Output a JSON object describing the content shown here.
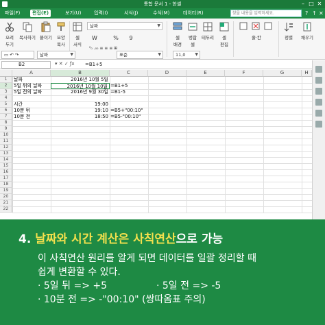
{
  "window": {
    "title": "통합 문서 1 - 한셀",
    "minimize": "–",
    "maximize": "□",
    "close": "✕"
  },
  "menu": {
    "items": [
      "파일(F)",
      "편집(E)",
      "보기(U)",
      "입력(I)",
      "서식(J)",
      "수식(M)",
      "데이터(R)"
    ],
    "active_index": 1,
    "search_placeholder": "찾을 내용을 입력하세요.",
    "right_icons": [
      "?",
      "↑",
      "✕"
    ]
  },
  "ribbon": {
    "cut": "오려\n두기",
    "copy": "복사하기",
    "paste": "붙이기",
    "format_copy": "모양\n복사",
    "cell_style": "셀\n서식",
    "font_name": "날짜",
    "font_size": "11,0",
    "bold": "W",
    "percent": "%",
    "comma": "9",
    "insert": "셀\n배경",
    "merge": "병합\n셀",
    "border": "테두리",
    "cell_edit": "셀\n편집",
    "rows": "줄·칸",
    "sort": "정렬",
    "fill": "채우기",
    "number_format": "날짜",
    "chart_label": "표준"
  },
  "formula_bar": {
    "cell_ref": "B2",
    "formula": "=B1+5"
  },
  "sheet": {
    "columns": [
      "A",
      "B",
      "C",
      "D",
      "E",
      "F",
      "G",
      "H"
    ],
    "selected_column": "B",
    "selected_row": 2,
    "rows": [
      {
        "n": "1",
        "a": "날짜",
        "b": "2016년 10월 5일",
        "c": ""
      },
      {
        "n": "2",
        "a": "5일 뒤의 날짜",
        "b": "2016년 10월 10일",
        "c": "=B1+5"
      },
      {
        "n": "3",
        "a": "5일 전의 날짜",
        "b": "2016년 9월 30일",
        "c": "=B1-5"
      },
      {
        "n": "4",
        "a": "",
        "b": "",
        "c": ""
      },
      {
        "n": "5",
        "a": "시간",
        "b": "19:00",
        "c": ""
      },
      {
        "n": "6",
        "a": "10분 뒤",
        "b": "19:10",
        "c": "=B5+\"00:10\""
      },
      {
        "n": "7",
        "a": "10분 전",
        "b": "18:50",
        "c": "=B5-\"00:10\""
      },
      {
        "n": "8",
        "a": "",
        "b": "",
        "c": ""
      },
      {
        "n": "9",
        "a": "",
        "b": "",
        "c": ""
      },
      {
        "n": "10",
        "a": "",
        "b": "",
        "c": ""
      },
      {
        "n": "11",
        "a": "",
        "b": "",
        "c": ""
      },
      {
        "n": "12",
        "a": "",
        "b": "",
        "c": ""
      },
      {
        "n": "13",
        "a": "",
        "b": "",
        "c": ""
      },
      {
        "n": "14",
        "a": "",
        "b": "",
        "c": ""
      },
      {
        "n": "15",
        "a": "",
        "b": "",
        "c": ""
      },
      {
        "n": "16",
        "a": "",
        "b": "",
        "c": ""
      },
      {
        "n": "17",
        "a": "",
        "b": "",
        "c": ""
      },
      {
        "n": "18",
        "a": "",
        "b": "",
        "c": ""
      },
      {
        "n": "19",
        "a": "",
        "b": "",
        "c": ""
      },
      {
        "n": "20",
        "a": "",
        "b": "",
        "c": ""
      },
      {
        "n": "21",
        "a": "",
        "b": "",
        "c": ""
      },
      {
        "n": "22",
        "a": "",
        "b": "",
        "c": ""
      }
    ]
  },
  "overlay": {
    "number": "4.",
    "title_part1": "날짜와 시간 계산은",
    "title_part2": "사칙연산",
    "title_part3": "으로 가능",
    "line1": "이 사칙연산 원리를 알게 되면 데이터를 일괄 정리할 때",
    "line2": "쉽게 변환할 수 있다.",
    "bullet1": "· 5일 뒤  =>  +5",
    "bullet2": "· 5일 전  =>  -5",
    "bullet3": "· 10분 전  =>  -\"00:10\" (쌍따옴표 주의)"
  },
  "colors": {
    "brand_green": "#1e8a44",
    "highlight_yellow": "#f4e04d"
  }
}
